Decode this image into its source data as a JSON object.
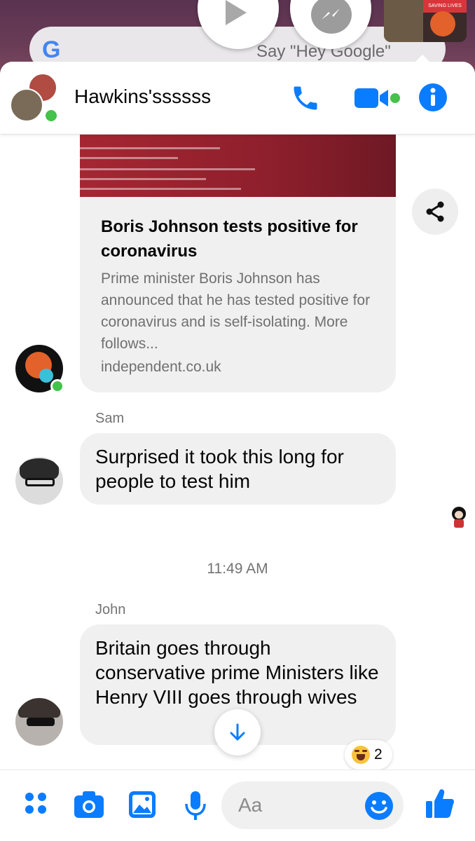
{
  "background": {
    "search_logo": "G",
    "search_hint": "Say \"Hey Google\"",
    "chathead_tag": "SAVING LIVES"
  },
  "header": {
    "title": "Hawkins'ssssss",
    "icons": [
      "phone-icon",
      "video-camera-icon",
      "info-icon"
    ]
  },
  "link_card": {
    "title": "Boris Johnson tests positive for coronavirus",
    "description": "Prime minister Boris Johnson has announced that he has tested positive for coronavirus and is self-isolating. More follows...",
    "domain": "independent.co.uk"
  },
  "messages": [
    {
      "sender": "Sam",
      "text": "Surprised it took this long for people to test him"
    },
    {
      "sender": "John",
      "text": "Britain goes through conservative prime Ministers like Henry VIII goes through wives"
    }
  ],
  "timestamp": "11:49 AM",
  "reaction": {
    "emoji": "laughing-crying-emoji",
    "count": "2"
  },
  "composer": {
    "placeholder": "Aa",
    "icons": [
      "more-icon",
      "camera-icon",
      "gallery-icon",
      "microphone-icon",
      "emoji-icon",
      "thumbs-up-icon"
    ]
  },
  "colors": {
    "accent": "#0a7cff",
    "bubble": "#f0f0f0",
    "online": "#44c24a"
  }
}
